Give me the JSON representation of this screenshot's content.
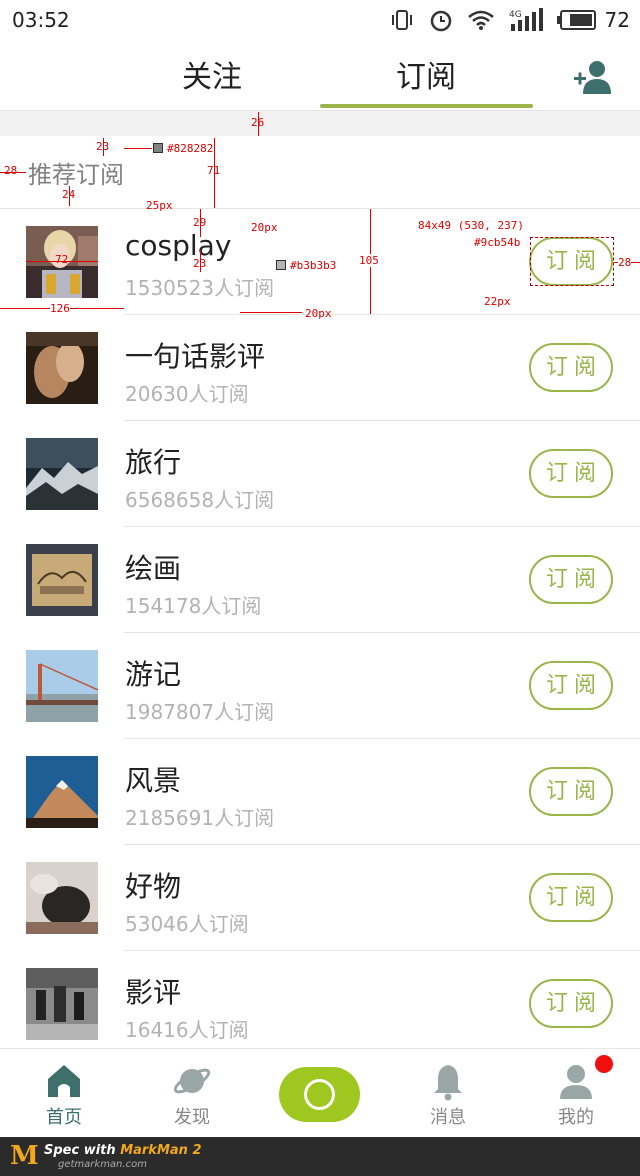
{
  "status_bar": {
    "time": "03:52",
    "battery": "72",
    "network": "4G"
  },
  "tabs": {
    "follow": "关注",
    "subscribe": "订阅",
    "active": "subscribe"
  },
  "section_title": "推荐订阅",
  "subscribe_label": "订阅",
  "items": [
    {
      "name": "cosplay",
      "count": "1530523人订阅"
    },
    {
      "name": "一句话影评",
      "count": "20630人订阅"
    },
    {
      "name": "旅行",
      "count": "6568658人订阅"
    },
    {
      "name": "绘画",
      "count": "154178人订阅"
    },
    {
      "name": "游记",
      "count": "1987807人订阅"
    },
    {
      "name": "风景",
      "count": "2185691人订阅"
    },
    {
      "name": "好物",
      "count": "53046人订阅"
    },
    {
      "name": "影评",
      "count": "16416人订阅"
    }
  ],
  "bottom_nav": {
    "home": "首页",
    "discover": "发现",
    "messages": "消息",
    "mine": "我的"
  },
  "colors": {
    "accent": "#9cb54b",
    "title_gray": "#828282",
    "count_gray": "#b3b3b3",
    "nav_active": "#3e6f6c",
    "badge": "#f20f0f"
  },
  "annotations": {
    "band": "26",
    "title_top": "23",
    "title_color": "#828282",
    "title_left": "28",
    "title_gap": "71",
    "title_bottom": "24",
    "title_size": "25px",
    "img_top": "29",
    "name_size": "20px",
    "name_gap": "23",
    "thumb_size": "72",
    "count_color": "#b3b3b3",
    "count_size": "20px",
    "row_height": "105",
    "text_left": "126",
    "btn_spec": "84x49 (530, 237)",
    "btn_color": "#9cb54b",
    "btn_right": "28",
    "btn_size": "22px"
  },
  "footer": {
    "spec_prefix": "Spec with ",
    "brand": "MarkMan 2",
    "site": "getmarkman.com"
  }
}
